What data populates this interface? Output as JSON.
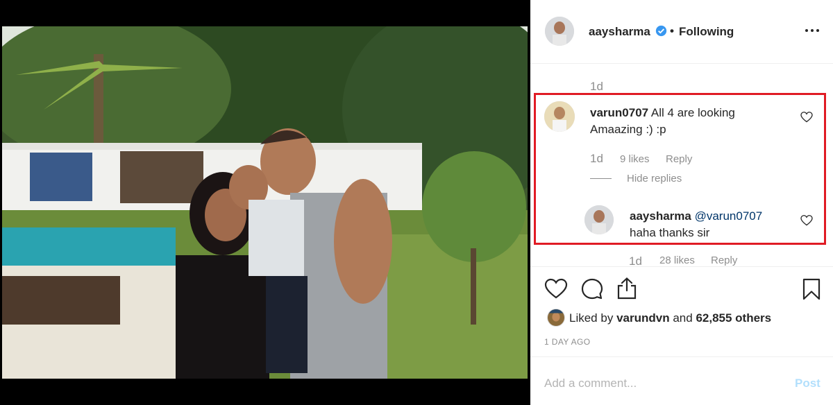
{
  "post": {
    "photo_alt": "family photo by the pool",
    "username": "aaysharma",
    "verified": true,
    "separator": "•",
    "follow_status": "Following",
    "more_icon": "more-horizontal-icon"
  },
  "comments": {
    "partial_top_time": "1d",
    "highlight_color": "#e01b24",
    "thread": {
      "username": "varun0707",
      "text": "All 4 are looking Amaazing :) :p",
      "time": "1d",
      "likes": "9 likes",
      "reply_label": "Reply",
      "hide_replies": "Hide replies",
      "reply": {
        "username": "aaysharma",
        "mention": "@varun0707",
        "text": "haha thanks sir"
      }
    },
    "partial_bottom": {
      "time": "1d",
      "likes": "28 likes",
      "reply_label": "Reply"
    }
  },
  "actions": {
    "icons": [
      "heart-icon",
      "comment-icon",
      "share-icon",
      "bookmark-icon"
    ],
    "liked_by_prefix": "Liked by",
    "liked_by_user": "varundvn",
    "liked_by_and": "and",
    "liked_by_others": "62,855 others",
    "time_ago": "1 DAY AGO"
  },
  "add_comment": {
    "placeholder": "Add a comment...",
    "post_label": "Post"
  },
  "colors": {
    "accent_link": "#003569",
    "post_disabled": "#b2dffc",
    "verified": "#3897f0"
  }
}
